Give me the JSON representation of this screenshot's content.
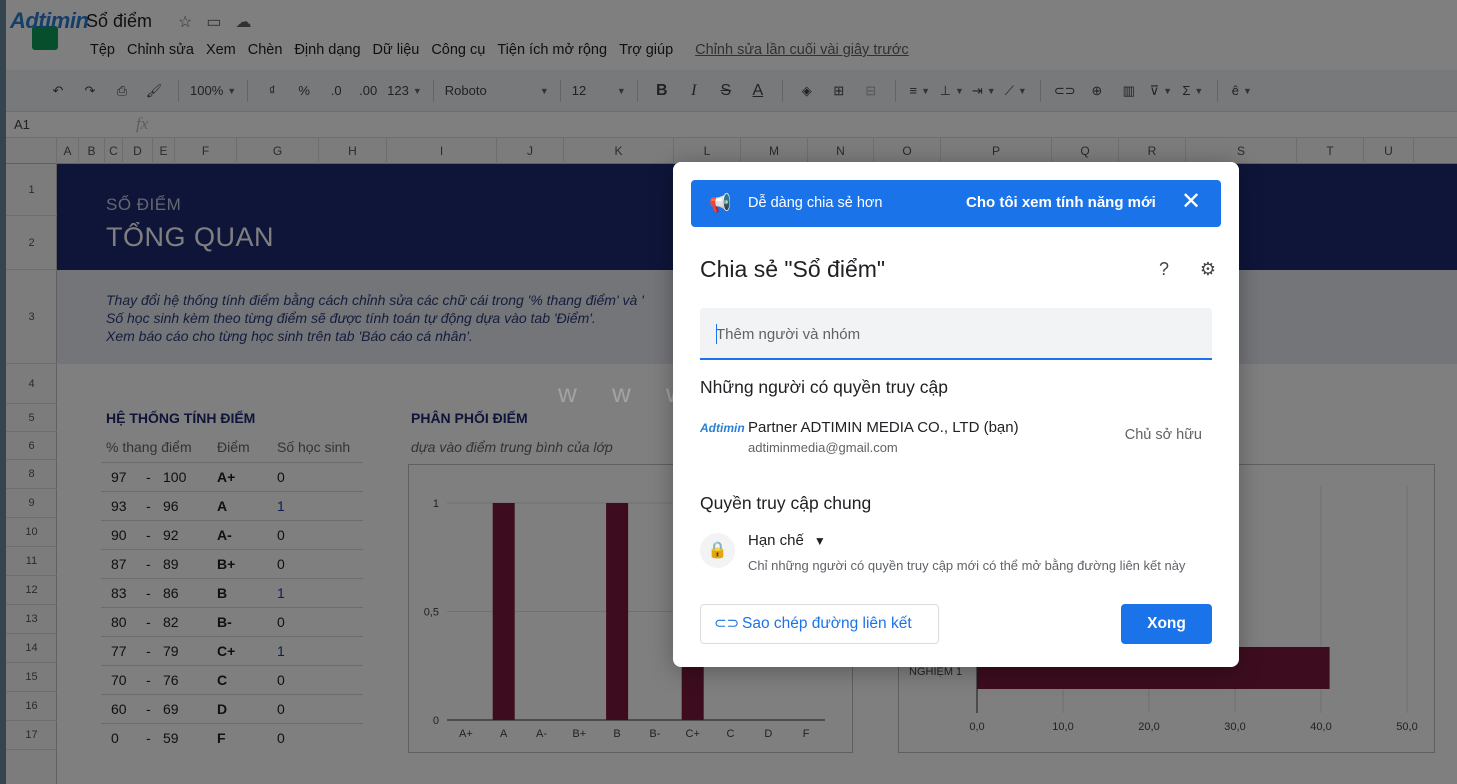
{
  "app": {
    "logo_text": "Adtimin",
    "doc_title": "Sổ điểm"
  },
  "menu": {
    "items": [
      "Tệp",
      "Chỉnh sửa",
      "Xem",
      "Chèn",
      "Định dạng",
      "Dữ liệu",
      "Công cụ",
      "Tiện ích mở rộng",
      "Trợ giúp"
    ],
    "last_edit": "Chỉnh sửa lần cuối vài giây trước"
  },
  "toolbar": {
    "zoom": "100%",
    "currency": "₫",
    "percent": "%",
    "dec_less": ".0",
    "dec_more": ".00",
    "format": "123",
    "font": "Roboto",
    "font_size": "12"
  },
  "formula": {
    "cell_ref": "A1",
    "fx": "fx"
  },
  "columns": [
    "A",
    "B",
    "C",
    "D",
    "E",
    "F",
    "G",
    "H",
    "I",
    "J",
    "K",
    "L",
    "M",
    "N",
    "O",
    "P",
    "Q",
    "R",
    "S",
    "T",
    "U"
  ],
  "rows": [
    "1",
    "2",
    "3",
    "4",
    "5",
    "6",
    "8",
    "9",
    "10",
    "11",
    "12",
    "13",
    "14",
    "15",
    "16",
    "17"
  ],
  "sheet": {
    "banner_sub": "SỔ ĐIỂM",
    "banner_title": "TỔNG QUAN",
    "instructions": [
      "Thay đổi hệ thống tính điểm bằng cách chỉnh sửa các chữ cái trong '% thang điểm' và '",
      "Số học sinh kèm theo từng điểm sẽ được tính toán tự động dựa vào tab 'Điểm'.",
      "Xem báo cáo cho từng học sinh trên tab 'Báo cáo cá nhân'."
    ],
    "grading_title": "HỆ THỐNG TÍNH ĐIỂM",
    "col_scale": "% thang điểm",
    "col_grade": "Điểm",
    "col_count": "Số học sinh",
    "grades": [
      {
        "lo": "97",
        "hi": "100",
        "g": "A+",
        "n": "0"
      },
      {
        "lo": "93",
        "hi": "96",
        "g": "A",
        "n": "1"
      },
      {
        "lo": "90",
        "hi": "92",
        "g": "A-",
        "n": "0"
      },
      {
        "lo": "87",
        "hi": "89",
        "g": "B+",
        "n": "0"
      },
      {
        "lo": "83",
        "hi": "86",
        "g": "B",
        "n": "1"
      },
      {
        "lo": "80",
        "hi": "82",
        "g": "B-",
        "n": "0"
      },
      {
        "lo": "77",
        "hi": "79",
        "g": "C+",
        "n": "1"
      },
      {
        "lo": "70",
        "hi": "76",
        "g": "C",
        "n": "0"
      },
      {
        "lo": "60",
        "hi": "69",
        "g": "D",
        "n": "0"
      },
      {
        "lo": "0",
        "hi": "59",
        "g": "F",
        "n": "0"
      }
    ],
    "dist_title": "PHÂN PHỐI ĐIỂM",
    "dist_sub": "dựa vào điểm trung bình của lớp"
  },
  "chart_data": [
    {
      "type": "bar",
      "categories": [
        "A+",
        "A",
        "A-",
        "B+",
        "B",
        "B-",
        "C+",
        "C",
        "D",
        "F"
      ],
      "values": [
        0,
        1,
        0,
        0,
        1,
        0,
        1,
        0,
        0,
        0
      ],
      "ylim": [
        0,
        1
      ],
      "yticks": [
        "0",
        "0,5",
        "1"
      ],
      "color": "#7a1a3f"
    },
    {
      "type": "bar",
      "orientation": "horizontal",
      "categories": [
        "NGHIỆM 1"
      ],
      "values": [
        41
      ],
      "xlim": [
        0,
        50
      ],
      "xticks": [
        "0,0",
        "10,0",
        "20,0",
        "30,0",
        "40,0",
        "50,0"
      ],
      "color": "#7a1a3f"
    }
  ],
  "watermark": "w w w . a d t i m i n . v n",
  "dialog": {
    "promo_text": "Dễ dàng chia sẻ hơn",
    "promo_action": "Cho tôi xem tính năng mới",
    "title": "Chia sẻ \"Sổ điểm\"",
    "add_placeholder": "Thêm người và nhóm",
    "access_heading": "Những người có quyền truy cập",
    "person_avatar": "Adtimin",
    "person_name": "Partner ADTIMIN MEDIA CO., LTD (bạn)",
    "person_email": "adtiminmedia@gmail.com",
    "person_role": "Chủ sở hữu",
    "general_heading": "Quyền truy cập chung",
    "restriction": "Hạn chế",
    "restriction_desc": "Chỉ những người có quyền truy cập mới có thể mở bằng đường liên kết này",
    "copy_link": "Sao chép đường liên kết",
    "done": "Xong"
  },
  "icons": {
    "star": "star-icon",
    "folder": "move-folder-icon",
    "cloud": "cloud-status-icon",
    "megaphone": "megaphone-icon",
    "close": "close-icon",
    "help": "help-icon",
    "settings": "gear-icon",
    "lock": "lock-icon",
    "link": "link-icon"
  },
  "colors": {
    "banner": "#1c2b72",
    "accent": "#1a73e8",
    "bar": "#7a1a3f"
  }
}
